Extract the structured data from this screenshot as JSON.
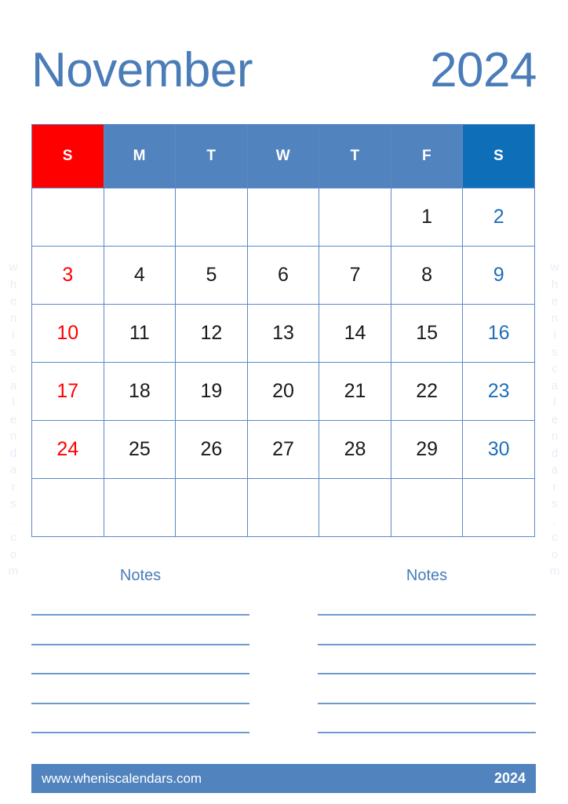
{
  "title": {
    "month": "November",
    "year": "2024"
  },
  "colors": {
    "accent_blue": "#4a7cb8",
    "header_weekday_bg": "#5183be",
    "header_sunday_bg": "#ff0000",
    "header_saturday_bg": "#0e6eb8",
    "grid_border": "#5b89c7",
    "sunday_text": "#ff0000",
    "saturday_text": "#1f6fb8",
    "weekday_text": "#1a1a1a",
    "footer_bg": "#5183be",
    "notes_line": "#6f9ad0",
    "watermark": "#e6edf8"
  },
  "calendar": {
    "weekday_headers": [
      {
        "label": "S",
        "kind": "sun",
        "name": "sunday"
      },
      {
        "label": "M",
        "kind": "mid",
        "name": "monday"
      },
      {
        "label": "T",
        "kind": "mid",
        "name": "tuesday"
      },
      {
        "label": "W",
        "kind": "mid",
        "name": "wednesday"
      },
      {
        "label": "T",
        "kind": "mid",
        "name": "thursday"
      },
      {
        "label": "F",
        "kind": "mid",
        "name": "friday"
      },
      {
        "label": "S",
        "kind": "sat",
        "name": "saturday"
      }
    ],
    "weeks": [
      [
        "",
        "",
        "",
        "",
        "",
        "1",
        "2"
      ],
      [
        "3",
        "4",
        "5",
        "6",
        "7",
        "8",
        "9"
      ],
      [
        "10",
        "11",
        "12",
        "13",
        "14",
        "15",
        "16"
      ],
      [
        "17",
        "18",
        "19",
        "20",
        "21",
        "22",
        "23"
      ],
      [
        "24",
        "25",
        "26",
        "27",
        "28",
        "29",
        "30"
      ],
      [
        "",
        "",
        "",
        "",
        "",
        "",
        ""
      ]
    ]
  },
  "notes": {
    "columns": [
      {
        "title": "Notes",
        "lines": 5
      },
      {
        "title": "Notes",
        "lines": 5
      }
    ]
  },
  "footer": {
    "website": "www.wheniscalendars.com",
    "year": "2024"
  },
  "watermark": {
    "text": "wheniscalendars.com"
  }
}
